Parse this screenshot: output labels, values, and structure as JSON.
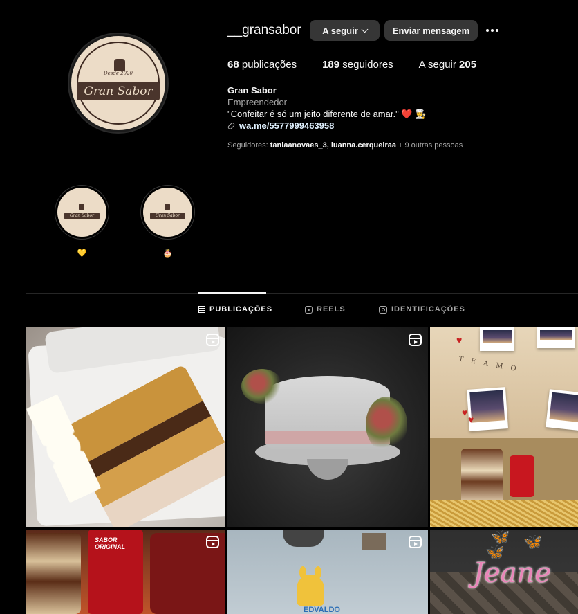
{
  "profile": {
    "username": "__gransabor",
    "follow_button": "A seguir",
    "message_button": "Enviar mensagem",
    "logo_text": "Gran Sabor",
    "logo_desde": "Desde 2020"
  },
  "stats": {
    "posts_count": "68",
    "posts_label": " publicações",
    "followers_count": "189",
    "followers_label": " seguidores",
    "following_label": "A seguir ",
    "following_count": "205"
  },
  "bio": {
    "name": "Gran Sabor",
    "category": "Empreendedor",
    "text": "\"Confeitar é só um jeito diferente de amar.\"",
    "emoji_heart": "❤️",
    "emoji_chef": "👨‍🍳",
    "link": "wa.me/5577999463958"
  },
  "followed_by": {
    "prefix": "Seguidores: ",
    "users": "taniaanovaes_3, luanna.cerqueiraa",
    "suffix": " + 9 outras pessoas"
  },
  "highlights": [
    {
      "label": "💛"
    },
    {
      "label": "🎂"
    }
  ],
  "tabs": {
    "posts": "PUBLICAÇÕES",
    "reels": "REELS",
    "tagged": "IDENTIFICAÇÕES"
  },
  "posts": [
    {
      "type": "reel",
      "desc_icon": "reel-icon"
    },
    {
      "type": "reel",
      "desc_icon": "reel-icon"
    },
    {
      "type": "image",
      "garland": "T E   A M O"
    },
    {
      "type": "reel",
      "label": "SABOR ORIGINAL"
    },
    {
      "type": "reel",
      "label": "EDVALDO"
    },
    {
      "type": "image",
      "label": "Jeane"
    }
  ],
  "colors": {
    "background": "#000000",
    "button_bg": "#363636",
    "secondary_text": "#a8a8a8",
    "link": "#e0f1ff"
  }
}
